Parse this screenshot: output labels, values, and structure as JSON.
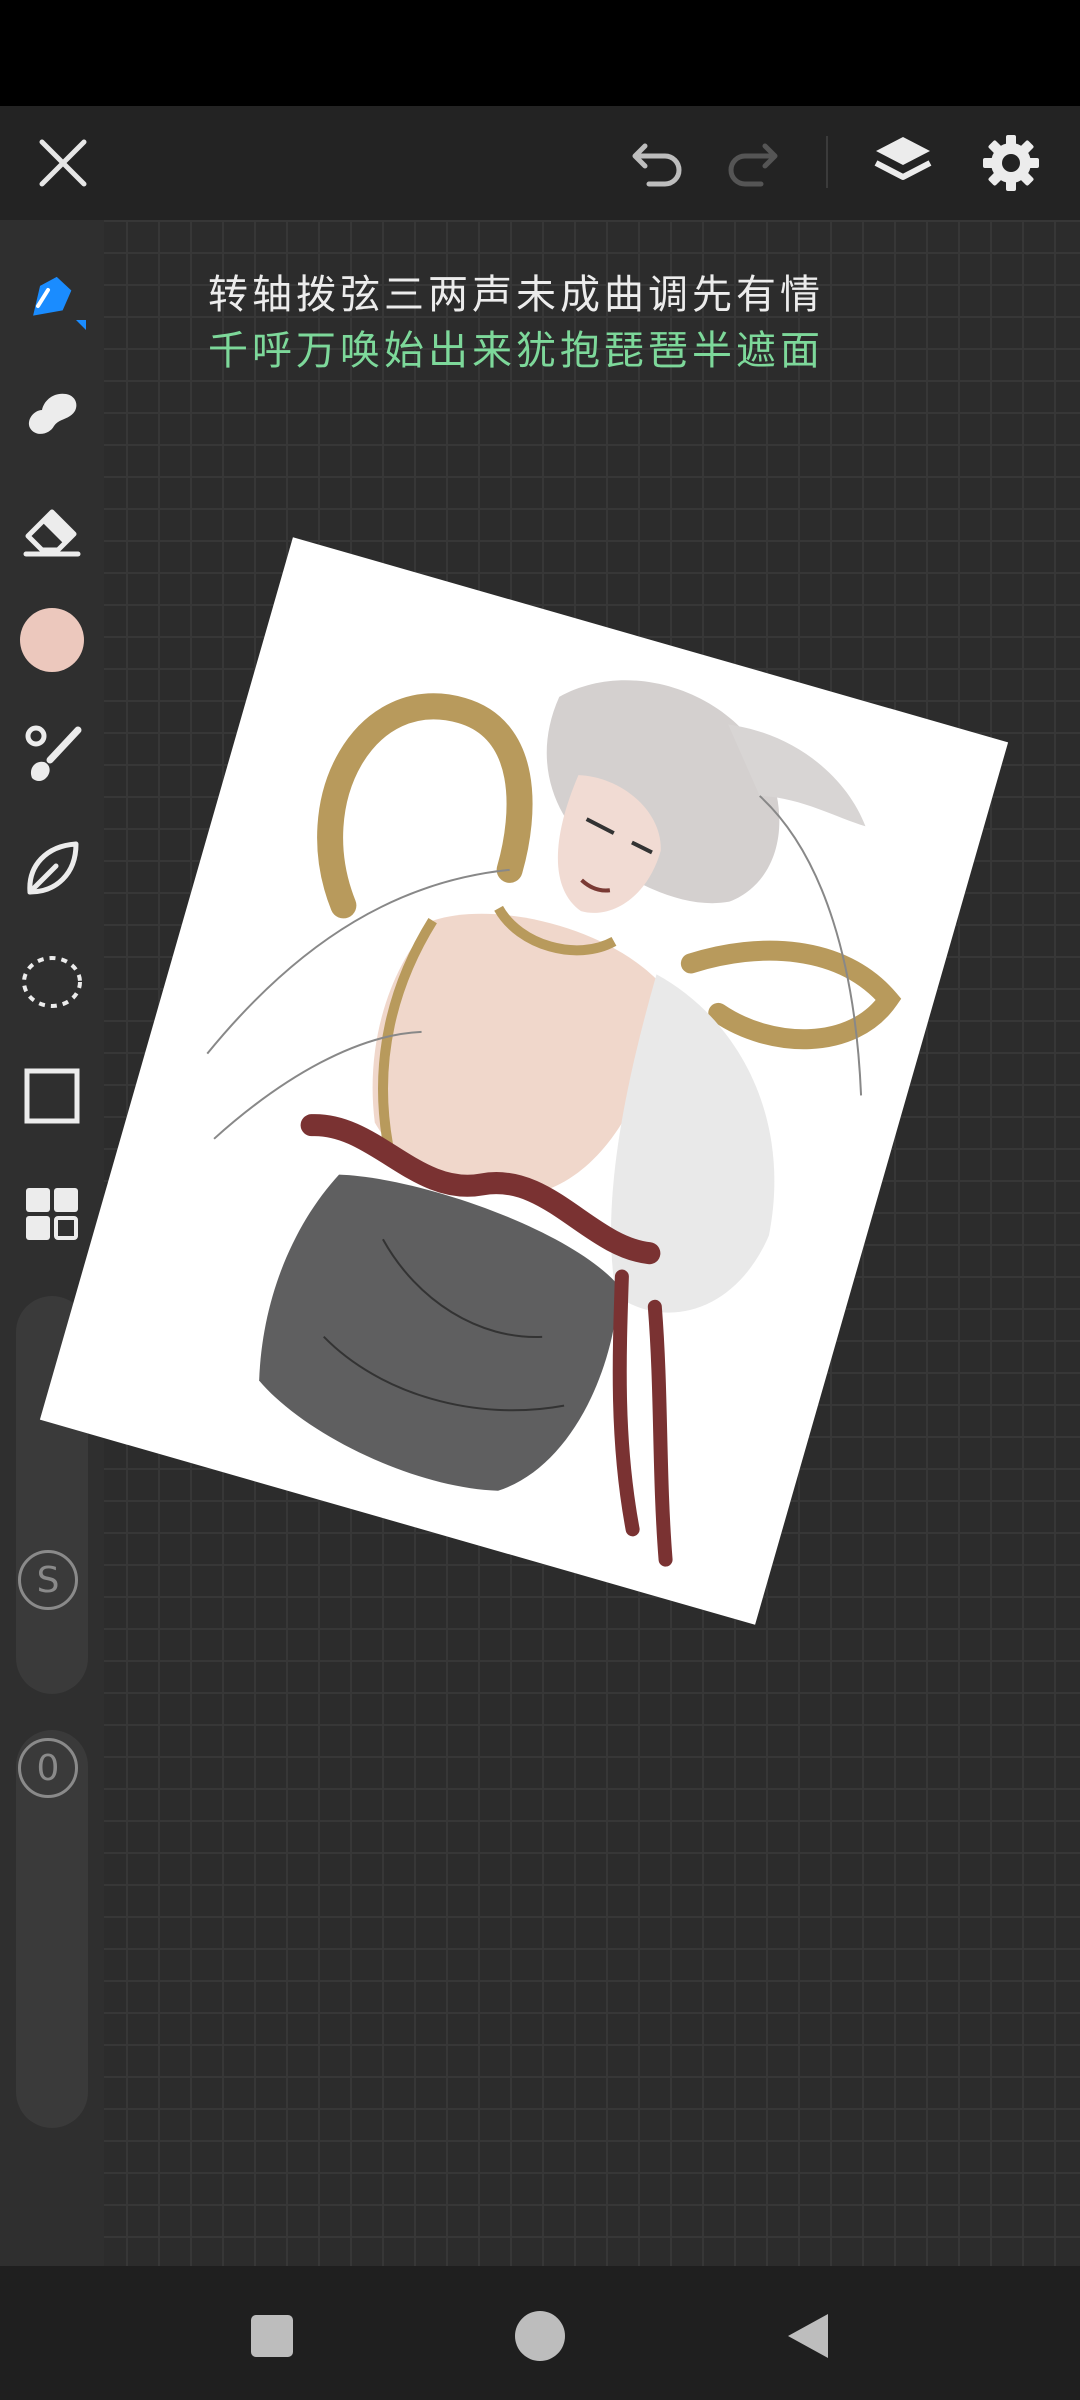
{
  "poem": {
    "line1": "转轴拨弦三两声未成曲调先有情",
    "line2": "千呼万唤始出来犹抱琵琶半遮面"
  },
  "toolbar": {
    "close": "close-icon",
    "undo": "undo-icon",
    "redo": "redo-icon",
    "layers": "layers-icon",
    "settings": "gear-icon"
  },
  "tools": [
    "pen-tool-icon",
    "smudge-icon",
    "eraser-icon",
    "color-swatch",
    "brush-icon",
    "leaf-icon",
    "lasso-icon",
    "rectangle-icon",
    "grid-icon"
  ],
  "colors": {
    "active_tool": "#1a8cff",
    "current_color": "#ecc8bd",
    "poem_line2": "#7dd89a"
  },
  "sliders": {
    "size_badge": "S",
    "opacity_badge": "0"
  }
}
